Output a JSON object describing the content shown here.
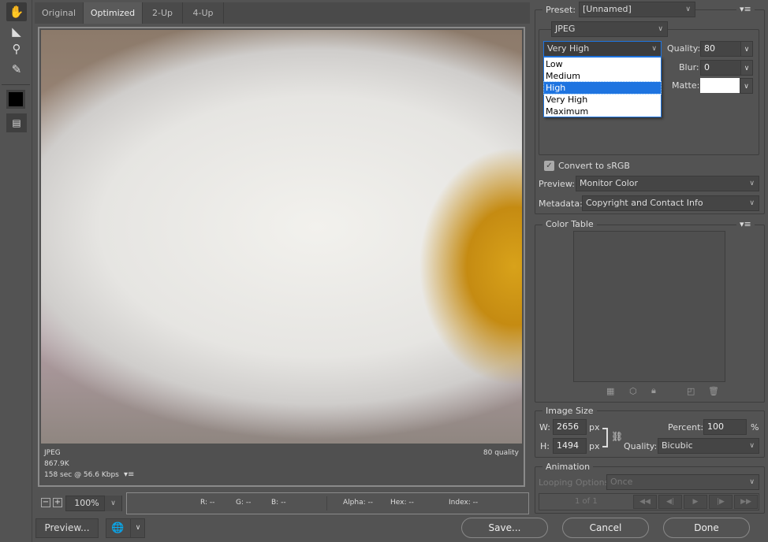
{
  "tools": {
    "items": [
      {
        "name": "hand-tool",
        "glyph": "✋"
      },
      {
        "name": "slice-select-tool",
        "glyph": "⯈"
      },
      {
        "name": "zoom-tool",
        "glyph": "⚲"
      },
      {
        "name": "eyedropper-tool",
        "glyph": "✎"
      }
    ],
    "color_swatch": "#000000"
  },
  "tabs": [
    {
      "label": "Original"
    },
    {
      "label": "Optimized",
      "active": true
    },
    {
      "label": "2-Up"
    },
    {
      "label": "4-Up"
    }
  ],
  "preview_info": {
    "format": "JPEG",
    "size": "867.9K",
    "download": "158 sec @ 56.6 Kbps",
    "quality": "80 quality"
  },
  "zoom": {
    "value": "100%"
  },
  "readout": {
    "r": "R: --",
    "g": "G: --",
    "b": "B: --",
    "alpha": "Alpha: --",
    "hex": "Hex: --",
    "index": "Index: --"
  },
  "bottom": {
    "preview": "Preview...",
    "save": "Save...",
    "cancel": "Cancel",
    "done": "Done"
  },
  "settings": {
    "preset_label": "Preset:",
    "preset_value": "[Unnamed]",
    "format": "JPEG",
    "quality_preset": "Very High",
    "quality_options": [
      "Low",
      "Medium",
      "High",
      "Very High",
      "Maximum"
    ],
    "highlighted_option": "High",
    "quality_label": "Quality:",
    "quality_value": "80",
    "blur_label": "Blur:",
    "blur_value": "0",
    "matte_label": "Matte:",
    "matte_color": "#ffffff",
    "convert_srgb": "Convert to sRGB",
    "convert_srgb_checked": true,
    "preview_label": "Preview:",
    "preview_value": "Monitor Color",
    "metadata_label": "Metadata:",
    "metadata_value": "Copyright and Contact Info"
  },
  "color_table": {
    "title": "Color Table"
  },
  "image_size": {
    "title": "Image Size",
    "w_label": "W:",
    "w_value": "2656",
    "h_label": "H:",
    "h_value": "1494",
    "unit": "px",
    "percent_label": "Percent:",
    "percent_value": "100",
    "percent_unit": "%",
    "quality_label": "Quality:",
    "quality_value": "Bicubic"
  },
  "animation": {
    "title": "Animation",
    "looping_label": "Looping Options:",
    "looping_value": "Once",
    "frame": "1 of 1"
  },
  "colors": {
    "bg": "#535353",
    "accent": "#1e74e0"
  }
}
